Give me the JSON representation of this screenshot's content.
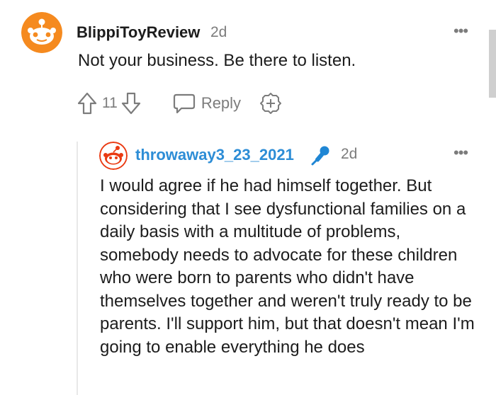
{
  "comment": {
    "author": "BlippiToyReview",
    "age": "2d",
    "more": "•••",
    "body": "Not your business. Be there to listen.",
    "vote_count": "11",
    "reply_label": "Reply",
    "icons": {
      "upvote": "arrow-up-outline-icon",
      "downvote": "arrow-down-outline-icon",
      "reply": "speech-bubble-icon",
      "award": "award-plus-icon",
      "avatar": "snoo-avatar-icon"
    },
    "colors": {
      "avatar_bg": "#f58a1f",
      "meta_gray": "#7c7c7c"
    }
  },
  "reply": {
    "author": "throwaway3_23_2021",
    "age": "2d",
    "more": "•••",
    "body": "I would agree if he had himself together. But considering that I see dysfunctional families on a daily basis with a multitude of problems, somebody needs to advocate for these children who were born to parents who didn't have themselves together and weren't truly ready to be parents. I'll support him, but that doesn't mean I'm going to enable everything he does",
    "icons": {
      "avatar": "snoo-avatar-icon",
      "flair": "microphone-icon"
    },
    "colors": {
      "author": "#2d8dd6",
      "avatar_bg": "#ea3a12"
    }
  }
}
